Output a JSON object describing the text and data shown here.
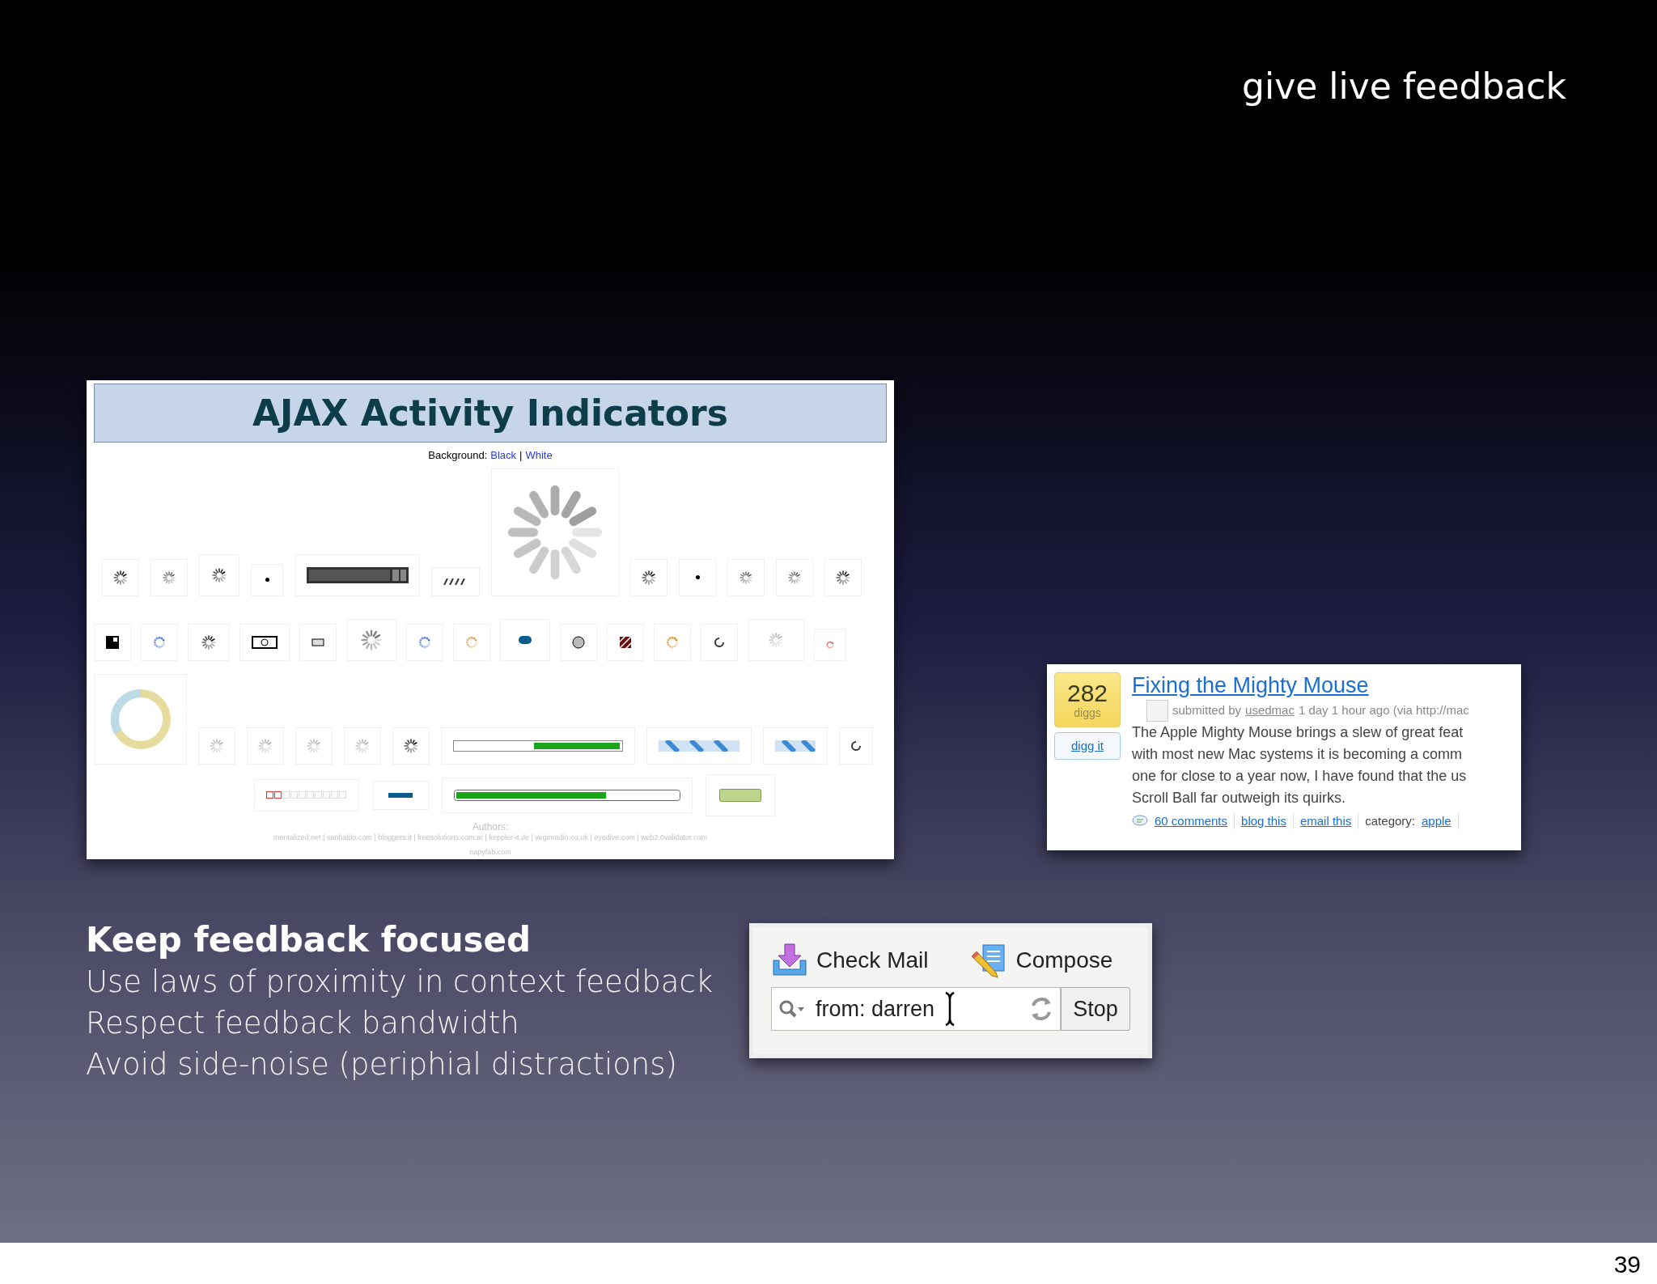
{
  "slide": {
    "title": "give live feedback",
    "page_number": "39"
  },
  "ajax_screenshot": {
    "title": "AJAX Activity Indicators",
    "background_label": "Background:",
    "background_links": [
      "Black",
      "White"
    ],
    "separator": "|",
    "authors_label": "Authors:",
    "authors": "mentalized.net | sanbaldo.com | bloggers.it | freesolutions.com.ar | keppler-it.de | virginradio.co.uk | eyedive.com | web2.0validator.com",
    "authors_more": "napyfab.com"
  },
  "digg_screenshot": {
    "count": "282",
    "count_label": "diggs",
    "digg_button": "digg it",
    "title": "Fixing the Mighty Mouse",
    "meta_prefix": "submitted by",
    "user": "usedmac",
    "meta_suffix": "1 day 1 hour ago (via http://mac",
    "body": [
      "The Apple Mighty Mouse brings a slew of great feat",
      "with most new Mac systems it is becoming a comm",
      "one for close to a year now, I have found that the us",
      "Scroll Ball far outweigh its quirks."
    ],
    "links": [
      "60 comments",
      "blog this",
      "email this"
    ],
    "category_label": "category:",
    "category": "apple"
  },
  "mail_screenshot": {
    "buttons": [
      {
        "kind": "check",
        "label": "Check Mail"
      },
      {
        "kind": "compose",
        "label": "Compose"
      }
    ],
    "search": {
      "value": "from: darren"
    },
    "stop_button": "Stop"
  },
  "bullets": {
    "heading": "Keep feedback focused",
    "lines": [
      "Use laws of proximity in context feedback",
      "Respect feedback bandwidth",
      "Avoid side-noise (periphial distractions)"
    ]
  }
}
